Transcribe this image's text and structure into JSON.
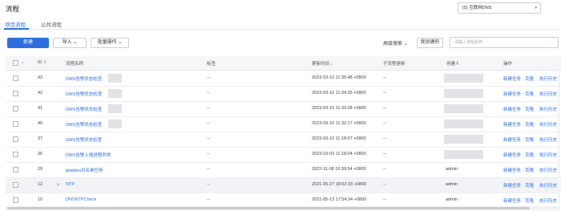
{
  "page": {
    "title": "流程"
  },
  "env": {
    "selected": "(5) 互联网DNS"
  },
  "tabs": [
    {
      "label": "项目流程",
      "active": true
    },
    {
      "label": "公共流程",
      "active": false
    }
  ],
  "toolbar": {
    "new_label": "新建",
    "import_label": "导入",
    "batch_label": "批量操作",
    "advanced_search_label": "高级搜索",
    "my_created_label": "我创建的",
    "search_placeholder": "请输入流程名称"
  },
  "table": {
    "columns": [
      "ID",
      "流程名称",
      "标签",
      "更新时间",
      "子流程更新",
      "创建人",
      "操作"
    ],
    "actions": [
      "新建任务",
      "克隆",
      "执行历史"
    ],
    "rows": [
      {
        "id": "43",
        "name": "DMS告警状态检查",
        "tag": "--",
        "updated": "2023-03-10 11:35:48 +0800",
        "sub": "--",
        "creator": ""
      },
      {
        "id": "42",
        "name": "DMS告警状态检查",
        "tag": "--",
        "updated": "2023-03-10 11:34:35 +0800",
        "sub": "--",
        "creator": ""
      },
      {
        "id": "41",
        "name": "DMS告警状态检查",
        "tag": "--",
        "updated": "2023-03-10 11:33:38 +0800",
        "sub": "--",
        "creator": ""
      },
      {
        "id": "40",
        "name": "DMS告警状态检查",
        "tag": "--",
        "updated": "2023-03-10 11:32:17 +0800",
        "sub": "--",
        "creator": ""
      },
      {
        "id": "37",
        "name": "DMS告警状态检查",
        "tag": "--",
        "updated": "2023-03-10 11:18:07 +0800",
        "sub": "--",
        "creator": ""
      },
      {
        "id": "36",
        "name": "DMS告警上报进程异常",
        "tag": "--",
        "updated": "2023-03-03 11:18:04 +0800",
        "sub": "--",
        "creator": ""
      },
      {
        "id": "29",
        "name": "iptables白名单任务",
        "tag": "--",
        "updated": "2022-11-08 16:39:54 +0800",
        "sub": "--",
        "creator": "admin"
      },
      {
        "id": "12",
        "name": "NTP",
        "tag": "--",
        "updated": "2021-05-27 18:02:33 +0800",
        "sub": "--",
        "creator": "admin"
      },
      {
        "id": "10",
        "name": "DNSNTPCheck",
        "tag": "--",
        "updated": "2021-05-13 17:54:34 +0800",
        "sub": "--",
        "creator": "admin"
      }
    ]
  },
  "colors": {
    "accent": "#2d6fde",
    "header_bg": "#f5f6f8",
    "row_highlight": "#f1f3f6"
  }
}
